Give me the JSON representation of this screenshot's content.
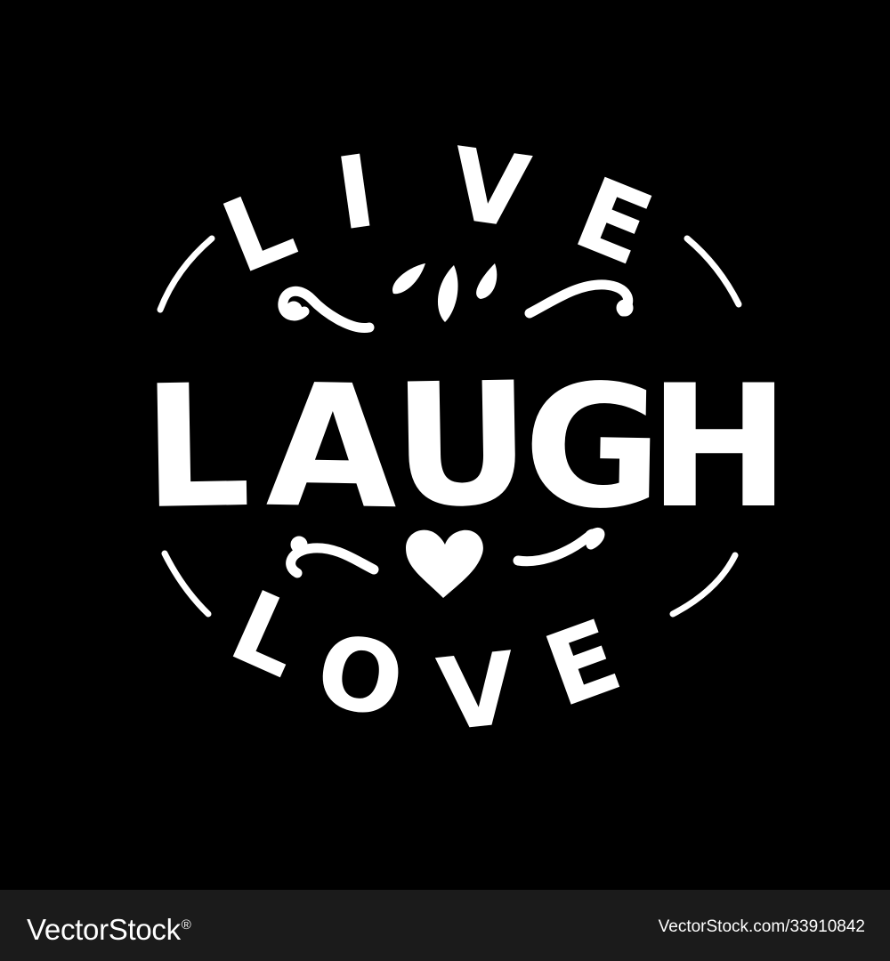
{
  "artwork": {
    "top_word": "LIVE",
    "top_letters": [
      "L",
      "I",
      "V",
      "E"
    ],
    "middle_word": "LAUGH",
    "middle_letters": [
      "L",
      "A",
      "U",
      "G",
      "H"
    ],
    "bottom_word": "LOVE",
    "bottom_letters": [
      "L",
      "O",
      "V",
      "E"
    ],
    "ornaments": [
      "swirl-icon",
      "drops-icon",
      "heart-icon"
    ],
    "colors": {
      "background": "#000000",
      "lettering": "#ffffff",
      "footer": "#1b1b1b"
    }
  },
  "footer": {
    "brand": "VectorStock",
    "brand_mark": "®",
    "reference": "VectorStock.com/33910842"
  }
}
